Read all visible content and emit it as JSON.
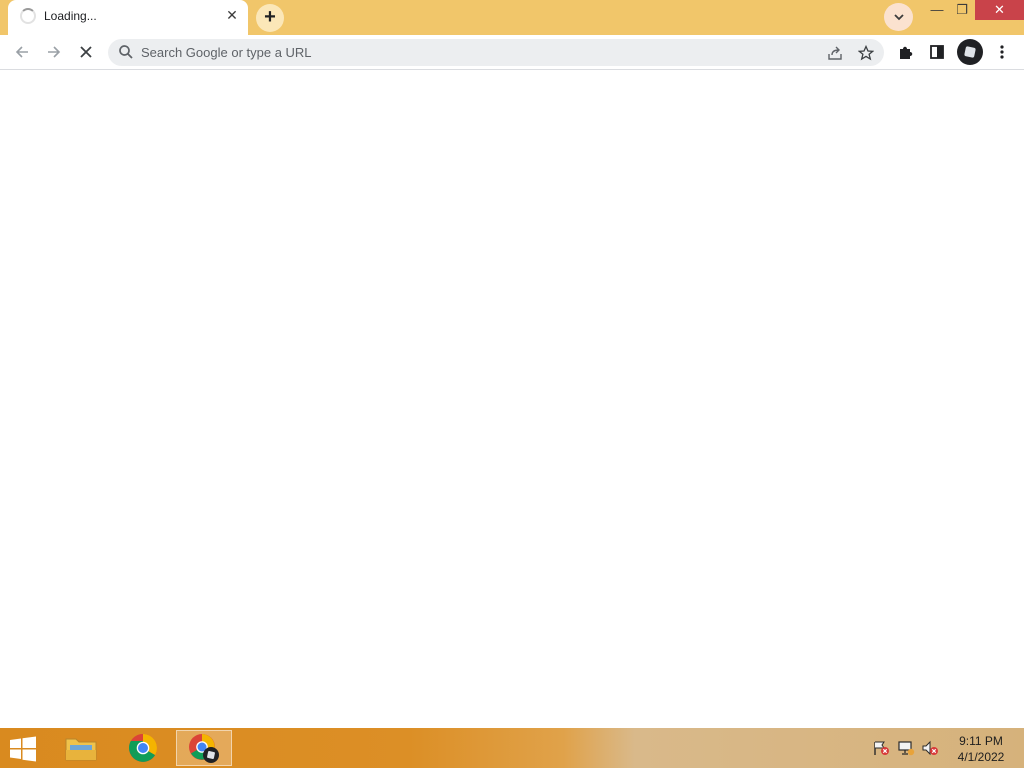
{
  "window": {
    "tab_title": "Loading...",
    "new_tab_label": "+",
    "tab_close_label": "✕",
    "tab_search_label": "⌄",
    "controls": {
      "minimize": "—",
      "maximize": "❐",
      "close": "✕"
    }
  },
  "toolbar": {
    "omnibox_placeholder": "Search Google or type a URL",
    "back_icon": "←",
    "forward_icon": "→",
    "stop_icon": "✕",
    "share_icon": "⇪",
    "star_icon": "☆",
    "extensions_icon": "✚",
    "sidepanel_icon": "▯",
    "menu_icon": "⋮"
  },
  "taskbar": {
    "apps": [
      {
        "name": "file-explorer"
      },
      {
        "name": "chrome"
      },
      {
        "name": "chrome-profile",
        "active": true
      }
    ],
    "tray": [
      "flag-icon",
      "network-icon",
      "volume-muted-icon"
    ],
    "time": "9:11 PM",
    "date": "4/1/2022"
  },
  "colors": {
    "tabstrip": "#f1c66a",
    "close_button": "#c9434a",
    "omnibox_bg": "#eceef0",
    "taskbar": "#d98a1f"
  }
}
